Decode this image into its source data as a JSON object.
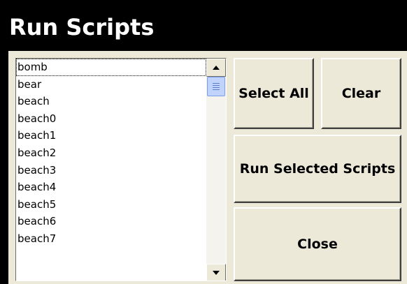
{
  "window": {
    "title": "Run Scripts"
  },
  "scripts_list": {
    "items": [
      "bomb",
      "bear",
      "beach",
      "beach0",
      "beach1",
      "beach2",
      "beach3",
      "beach4",
      "beach5",
      "beach6",
      "beach7"
    ],
    "focused_item": "bomb",
    "scrollbar": {
      "up_icon": "scroll-up-arrow-icon",
      "down_icon": "scroll-down-arrow-icon",
      "thumb_icon": "scroll-thumb-grip-icon"
    }
  },
  "buttons": {
    "select_all": "Select All",
    "clear": "Clear",
    "run_selected": "Run Selected Scripts",
    "close": "Close"
  },
  "colors": {
    "title_bar": "#000000",
    "title_text": "#ffffff",
    "dialog_face": "#ece9d8",
    "list_background": "#ffffff",
    "scroll_thumb": "#c1d3fb"
  }
}
